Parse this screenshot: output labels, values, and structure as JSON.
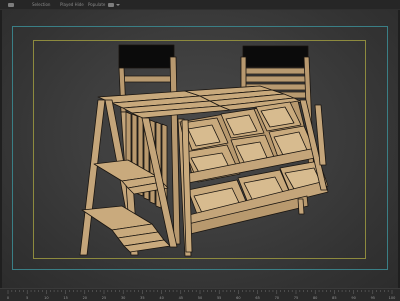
{
  "toolbar": {
    "items": [
      {
        "label": "Selection"
      },
      {
        "label": "Played Hide"
      },
      {
        "label": "Populate"
      }
    ]
  },
  "timeline": {
    "ticks": [
      "0",
      "5",
      "10",
      "15",
      "20",
      "25",
      "30",
      "35",
      "40",
      "45",
      "50",
      "55",
      "60",
      "65",
      "70",
      "75",
      "80",
      "85",
      "90",
      "95",
      "100"
    ]
  },
  "colors": {
    "viewport_bg": "#404040",
    "safe_frame_outer": "#3a7f86",
    "safe_frame_inner": "#8d8a3e",
    "wood": "#c4a57a",
    "wood_edge": "#1a1510"
  }
}
